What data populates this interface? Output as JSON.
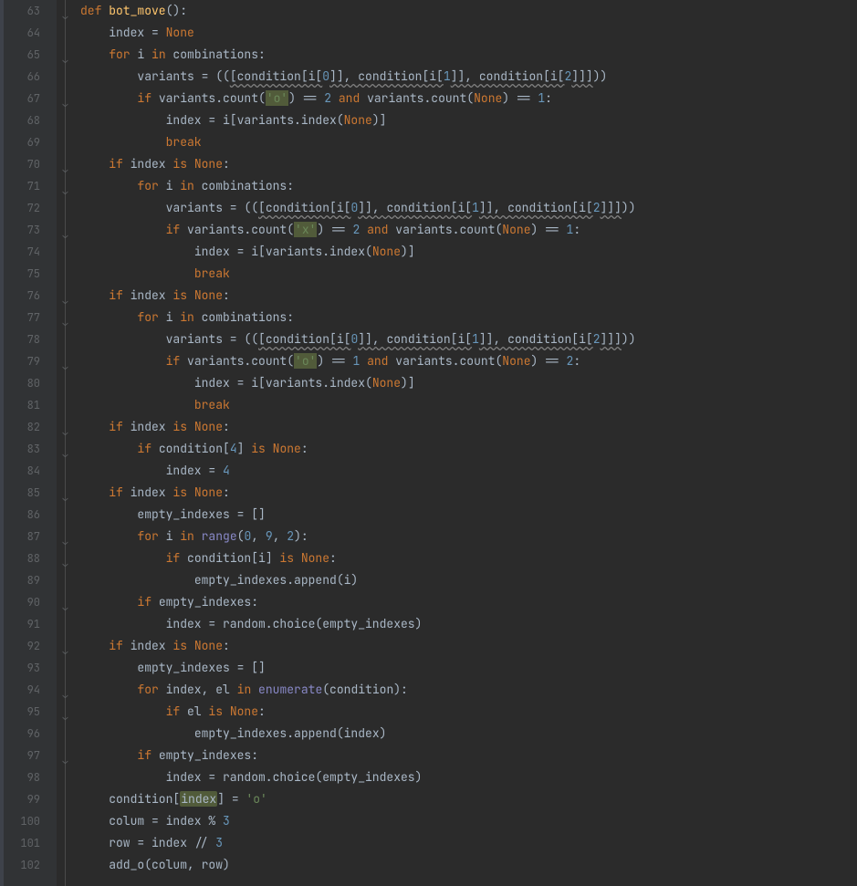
{
  "first_line": 63,
  "code_lines": [
    {
      "indent": 0,
      "tokens": [
        {
          "t": "def ",
          "c": "kw"
        },
        {
          "t": "bot_move",
          "c": "fn"
        },
        {
          "t": "():",
          "c": "op"
        }
      ]
    },
    {
      "indent": 1,
      "tokens": [
        {
          "t": "index = ",
          "c": "id"
        },
        {
          "t": "None",
          "c": "kw"
        }
      ]
    },
    {
      "indent": 1,
      "tokens": [
        {
          "t": "for ",
          "c": "kw"
        },
        {
          "t": "i ",
          "c": "id"
        },
        {
          "t": "in ",
          "c": "kw"
        },
        {
          "t": "combinations:",
          "c": "id"
        }
      ]
    },
    {
      "indent": 2,
      "tokens": [
        {
          "t": "variants = (",
          "c": "id"
        },
        {
          "t": "(",
          "c": "op"
        },
        {
          "t": "[condition[i[",
          "c": "uw"
        },
        {
          "t": "0",
          "c": "num"
        },
        {
          "t": "]], condition[i[",
          "c": "uw"
        },
        {
          "t": "1",
          "c": "num"
        },
        {
          "t": "]], condition[i[",
          "c": "uw"
        },
        {
          "t": "2",
          "c": "num"
        },
        {
          "t": "]]]",
          "c": "uw"
        },
        {
          "t": ")",
          "c": "op"
        },
        {
          "t": ")",
          "c": "id"
        }
      ]
    },
    {
      "indent": 2,
      "tokens": [
        {
          "t": "if ",
          "c": "kw"
        },
        {
          "t": "variants.count(",
          "c": "id"
        },
        {
          "t": "'o'",
          "c": "strhl"
        },
        {
          "t": ") == ",
          "c": "id"
        },
        {
          "t": "2",
          "c": "num"
        },
        {
          "t": " and ",
          "c": "kw"
        },
        {
          "t": "variants.count(",
          "c": "id"
        },
        {
          "t": "None",
          "c": "kw"
        },
        {
          "t": ") == ",
          "c": "id"
        },
        {
          "t": "1",
          "c": "num"
        },
        {
          "t": ":",
          "c": "id"
        }
      ]
    },
    {
      "indent": 3,
      "tokens": [
        {
          "t": "index = i[variants.index(",
          "c": "id"
        },
        {
          "t": "None",
          "c": "kw"
        },
        {
          "t": ")]",
          "c": "id"
        }
      ]
    },
    {
      "indent": 3,
      "tokens": [
        {
          "t": "break",
          "c": "kw"
        }
      ]
    },
    {
      "indent": 1,
      "tokens": [
        {
          "t": "if ",
          "c": "kw"
        },
        {
          "t": "index ",
          "c": "id"
        },
        {
          "t": "is ",
          "c": "kw"
        },
        {
          "t": "None",
          "c": "kw"
        },
        {
          "t": ":",
          "c": "id"
        }
      ]
    },
    {
      "indent": 2,
      "tokens": [
        {
          "t": "for ",
          "c": "kw"
        },
        {
          "t": "i ",
          "c": "id"
        },
        {
          "t": "in ",
          "c": "kw"
        },
        {
          "t": "combinations:",
          "c": "id"
        }
      ]
    },
    {
      "indent": 3,
      "tokens": [
        {
          "t": "variants = (",
          "c": "id"
        },
        {
          "t": "(",
          "c": "op"
        },
        {
          "t": "[condition[i[",
          "c": "uw"
        },
        {
          "t": "0",
          "c": "num"
        },
        {
          "t": "]], condition[i[",
          "c": "uw"
        },
        {
          "t": "1",
          "c": "num"
        },
        {
          "t": "]], condition[i[",
          "c": "uw"
        },
        {
          "t": "2",
          "c": "num"
        },
        {
          "t": "]]]",
          "c": "uw"
        },
        {
          "t": ")",
          "c": "op"
        },
        {
          "t": ")",
          "c": "id"
        }
      ]
    },
    {
      "indent": 3,
      "tokens": [
        {
          "t": "if ",
          "c": "kw"
        },
        {
          "t": "variants.count(",
          "c": "id"
        },
        {
          "t": "'x'",
          "c": "strhl"
        },
        {
          "t": ") == ",
          "c": "id"
        },
        {
          "t": "2",
          "c": "num"
        },
        {
          "t": " and ",
          "c": "kw"
        },
        {
          "t": "variants.count(",
          "c": "id"
        },
        {
          "t": "None",
          "c": "kw"
        },
        {
          "t": ") == ",
          "c": "id"
        },
        {
          "t": "1",
          "c": "num"
        },
        {
          "t": ":",
          "c": "id"
        }
      ]
    },
    {
      "indent": 4,
      "tokens": [
        {
          "t": "index = i[variants.index(",
          "c": "id"
        },
        {
          "t": "None",
          "c": "kw"
        },
        {
          "t": ")]",
          "c": "id"
        }
      ]
    },
    {
      "indent": 4,
      "tokens": [
        {
          "t": "break",
          "c": "kw"
        }
      ]
    },
    {
      "indent": 1,
      "tokens": [
        {
          "t": "if ",
          "c": "kw"
        },
        {
          "t": "index ",
          "c": "id"
        },
        {
          "t": "is ",
          "c": "kw"
        },
        {
          "t": "None",
          "c": "kw"
        },
        {
          "t": ":",
          "c": "id"
        }
      ]
    },
    {
      "indent": 2,
      "tokens": [
        {
          "t": "for ",
          "c": "kw"
        },
        {
          "t": "i ",
          "c": "id"
        },
        {
          "t": "in ",
          "c": "kw"
        },
        {
          "t": "combinations:",
          "c": "id"
        }
      ]
    },
    {
      "indent": 3,
      "tokens": [
        {
          "t": "variants = (",
          "c": "id"
        },
        {
          "t": "(",
          "c": "op"
        },
        {
          "t": "[condition[i[",
          "c": "uw"
        },
        {
          "t": "0",
          "c": "num"
        },
        {
          "t": "]], condition[i[",
          "c": "uw"
        },
        {
          "t": "1",
          "c": "num"
        },
        {
          "t": "]], condition[i[",
          "c": "uw"
        },
        {
          "t": "2",
          "c": "num"
        },
        {
          "t": "]]]",
          "c": "uw"
        },
        {
          "t": ")",
          "c": "op"
        },
        {
          "t": ")",
          "c": "id"
        }
      ]
    },
    {
      "indent": 3,
      "tokens": [
        {
          "t": "if ",
          "c": "kw"
        },
        {
          "t": "variants.count(",
          "c": "id"
        },
        {
          "t": "'o'",
          "c": "strhl"
        },
        {
          "t": ") == ",
          "c": "id"
        },
        {
          "t": "1",
          "c": "num"
        },
        {
          "t": " and ",
          "c": "kw"
        },
        {
          "t": "variants.count(",
          "c": "id"
        },
        {
          "t": "None",
          "c": "kw"
        },
        {
          "t": ") == ",
          "c": "id"
        },
        {
          "t": "2",
          "c": "num"
        },
        {
          "t": ":",
          "c": "id"
        }
      ]
    },
    {
      "indent": 4,
      "tokens": [
        {
          "t": "index = i[variants.index(",
          "c": "id"
        },
        {
          "t": "None",
          "c": "kw"
        },
        {
          "t": ")]",
          "c": "id"
        }
      ]
    },
    {
      "indent": 4,
      "tokens": [
        {
          "t": "break",
          "c": "kw"
        }
      ]
    },
    {
      "indent": 1,
      "tokens": [
        {
          "t": "if ",
          "c": "kw"
        },
        {
          "t": "index ",
          "c": "id"
        },
        {
          "t": "is ",
          "c": "kw"
        },
        {
          "t": "None",
          "c": "kw"
        },
        {
          "t": ":",
          "c": "id"
        }
      ]
    },
    {
      "indent": 2,
      "tokens": [
        {
          "t": "if ",
          "c": "kw"
        },
        {
          "t": "condition[",
          "c": "id"
        },
        {
          "t": "4",
          "c": "num"
        },
        {
          "t": "] ",
          "c": "id"
        },
        {
          "t": "is ",
          "c": "kw"
        },
        {
          "t": "None",
          "c": "kw"
        },
        {
          "t": ":",
          "c": "id"
        }
      ]
    },
    {
      "indent": 3,
      "tokens": [
        {
          "t": "index = ",
          "c": "id"
        },
        {
          "t": "4",
          "c": "num"
        }
      ]
    },
    {
      "indent": 1,
      "tokens": [
        {
          "t": "if ",
          "c": "kw"
        },
        {
          "t": "index ",
          "c": "id"
        },
        {
          "t": "is ",
          "c": "kw"
        },
        {
          "t": "None",
          "c": "kw"
        },
        {
          "t": ":",
          "c": "id"
        }
      ]
    },
    {
      "indent": 2,
      "tokens": [
        {
          "t": "empty_indexes = []",
          "c": "id"
        }
      ]
    },
    {
      "indent": 2,
      "tokens": [
        {
          "t": "for ",
          "c": "kw"
        },
        {
          "t": "i ",
          "c": "id"
        },
        {
          "t": "in ",
          "c": "kw"
        },
        {
          "t": "range",
          "c": "bi"
        },
        {
          "t": "(",
          "c": "id"
        },
        {
          "t": "0",
          "c": "num"
        },
        {
          "t": ", ",
          "c": "id"
        },
        {
          "t": "9",
          "c": "num"
        },
        {
          "t": ", ",
          "c": "id"
        },
        {
          "t": "2",
          "c": "num"
        },
        {
          "t": "):",
          "c": "id"
        }
      ]
    },
    {
      "indent": 3,
      "tokens": [
        {
          "t": "if ",
          "c": "kw"
        },
        {
          "t": "condition[i] ",
          "c": "id"
        },
        {
          "t": "is ",
          "c": "kw"
        },
        {
          "t": "None",
          "c": "kw"
        },
        {
          "t": ":",
          "c": "id"
        }
      ]
    },
    {
      "indent": 4,
      "tokens": [
        {
          "t": "empty_indexes.append(i)",
          "c": "id"
        }
      ]
    },
    {
      "indent": 2,
      "tokens": [
        {
          "t": "if ",
          "c": "kw"
        },
        {
          "t": "empty_indexes:",
          "c": "id"
        }
      ]
    },
    {
      "indent": 3,
      "tokens": [
        {
          "t": "index = random.choice(empty_indexes)",
          "c": "id"
        }
      ]
    },
    {
      "indent": 1,
      "tokens": [
        {
          "t": "if ",
          "c": "kw"
        },
        {
          "t": "index ",
          "c": "id"
        },
        {
          "t": "is ",
          "c": "kw"
        },
        {
          "t": "None",
          "c": "kw"
        },
        {
          "t": ":",
          "c": "id"
        }
      ]
    },
    {
      "indent": 2,
      "tokens": [
        {
          "t": "empty_indexes = []",
          "c": "id"
        }
      ]
    },
    {
      "indent": 2,
      "tokens": [
        {
          "t": "for ",
          "c": "kw"
        },
        {
          "t": "index",
          "c": "id"
        },
        {
          "t": ", ",
          "c": "op"
        },
        {
          "t": "el ",
          "c": "id"
        },
        {
          "t": "in ",
          "c": "kw"
        },
        {
          "t": "enumerate",
          "c": "bi"
        },
        {
          "t": "(condition):",
          "c": "id"
        }
      ]
    },
    {
      "indent": 3,
      "tokens": [
        {
          "t": "if ",
          "c": "kw"
        },
        {
          "t": "el ",
          "c": "id"
        },
        {
          "t": "is ",
          "c": "kw"
        },
        {
          "t": "None",
          "c": "kw"
        },
        {
          "t": ":",
          "c": "id"
        }
      ]
    },
    {
      "indent": 4,
      "tokens": [
        {
          "t": "empty_indexes.append(index)",
          "c": "id"
        }
      ]
    },
    {
      "indent": 2,
      "tokens": [
        {
          "t": "if ",
          "c": "kw"
        },
        {
          "t": "empty_indexes:",
          "c": "id"
        }
      ]
    },
    {
      "indent": 3,
      "tokens": [
        {
          "t": "index = random.choice(empty_indexes)",
          "c": "id"
        }
      ]
    },
    {
      "indent": 1,
      "tokens": [
        {
          "t": "condition[",
          "c": "id"
        },
        {
          "t": "index",
          "c": "hl"
        },
        {
          "t": "] = ",
          "c": "id"
        },
        {
          "t": "'o'",
          "c": "str"
        }
      ]
    },
    {
      "indent": 1,
      "tokens": [
        {
          "t": "colum = index % ",
          "c": "id"
        },
        {
          "t": "3",
          "c": "num"
        }
      ]
    },
    {
      "indent": 1,
      "tokens": [
        {
          "t": "row = index // ",
          "c": "id"
        },
        {
          "t": "3",
          "c": "num"
        }
      ]
    },
    {
      "indent": 1,
      "tokens": [
        {
          "t": "add_o(colum",
          "c": "id"
        },
        {
          "t": ", ",
          "c": "op"
        },
        {
          "t": "row)",
          "c": "id"
        }
      ]
    }
  ],
  "fold_markers": [
    0,
    2,
    4,
    7,
    8,
    10,
    13,
    14,
    16,
    19,
    20,
    22,
    24,
    25,
    27,
    29,
    31,
    32,
    34
  ]
}
